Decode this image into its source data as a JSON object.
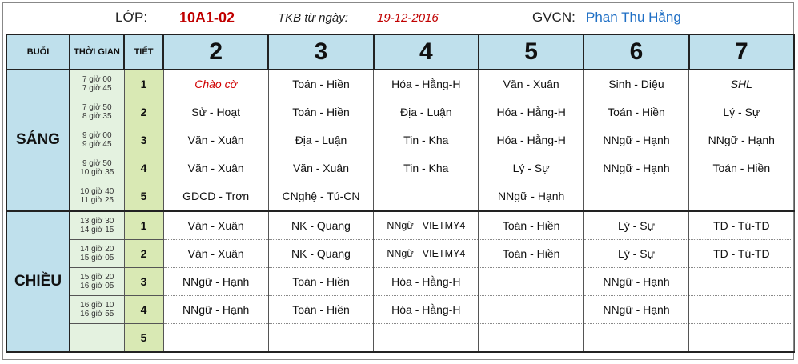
{
  "header": {
    "lop_label": "LỚP:",
    "class_name": "10A1-02",
    "tkb_label": "TKB từ ngày:",
    "date": "19-12-2016",
    "gvcn_label": "GVCN:",
    "teacher": "Phan Thu Hằng"
  },
  "columns": {
    "buoi": "BUỔI",
    "thoi_gian": "THỜI GIAN",
    "tiet": "TIẾT",
    "days": [
      "2",
      "3",
      "4",
      "5",
      "6",
      "7"
    ]
  },
  "sessions": [
    {
      "name": "SÁNG",
      "rows": [
        {
          "time_start": "7 giờ 00",
          "time_end": "7 giờ 45",
          "period": "1",
          "cells": [
            "Chào cờ",
            "Toán - Hiền",
            "Hóa - Hằng-H",
            "Văn - Xuân",
            "Sinh - Diệu",
            "SHL"
          ]
        },
        {
          "time_start": "7 giờ 50",
          "time_end": "8 giờ 35",
          "period": "2",
          "cells": [
            "Sử - Hoạt",
            "Toán - Hiền",
            "Địa - Luận",
            "Hóa - Hằng-H",
            "Toán - Hiền",
            "Lý - Sự"
          ]
        },
        {
          "time_start": "9 giờ 00",
          "time_end": "9 giờ 45",
          "period": "3",
          "cells": [
            "Văn - Xuân",
            "Địa - Luận",
            "Tin - Kha",
            "Hóa - Hằng-H",
            "NNgữ - Hạnh",
            "NNgữ - Hạnh"
          ]
        },
        {
          "time_start": "9 giờ 50",
          "time_end": "10 giờ 35",
          "period": "4",
          "cells": [
            "Văn - Xuân",
            "Văn - Xuân",
            "Tin - Kha",
            "Lý - Sự",
            "NNgữ - Hạnh",
            "Toán - Hiền"
          ]
        },
        {
          "time_start": "10 giờ 40",
          "time_end": "11 giờ 25",
          "period": "5",
          "cells": [
            "GDCD - Trơn",
            "CNghệ - Tú-CN",
            "",
            "NNgữ - Hạnh",
            "",
            ""
          ]
        }
      ]
    },
    {
      "name": "CHIỀU",
      "rows": [
        {
          "time_start": "13 giờ 30",
          "time_end": "14 giờ 15",
          "period": "1",
          "cells": [
            "Văn - Xuân",
            "NK - Quang",
            "NNgữ - VIETMY4",
            "Toán - Hiền",
            "Lý - Sự",
            "TD - Tú-TD"
          ]
        },
        {
          "time_start": "14 giờ 20",
          "time_end": "15 giờ 05",
          "period": "2",
          "cells": [
            "Văn - Xuân",
            "NK - Quang",
            "NNgữ - VIETMY4",
            "Toán - Hiền",
            "Lý - Sự",
            "TD - Tú-TD"
          ]
        },
        {
          "time_start": "15 giờ 20",
          "time_end": "16 giờ 05",
          "period": "3",
          "cells": [
            "NNgữ - Hạnh",
            "Toán - Hiền",
            "Hóa - Hằng-H",
            "",
            "NNgữ - Hạnh",
            ""
          ]
        },
        {
          "time_start": "16 giờ 10",
          "time_end": "16 giờ 55",
          "period": "4",
          "cells": [
            "NNgữ - Hạnh",
            "Toán - Hiền",
            "Hóa - Hằng-H",
            "",
            "NNgữ - Hạnh",
            ""
          ]
        },
        {
          "time_start": "",
          "time_end": "",
          "period": "5",
          "cells": [
            "",
            "",
            "",
            "",
            "",
            ""
          ]
        }
      ]
    }
  ],
  "colors": {
    "header_bg": "#bfe0ec",
    "time_bg": "#e4f2e0",
    "period_bg": "#d9e9b4",
    "accent_red": "#c00000",
    "teacher_blue": "#1f6fc5"
  }
}
